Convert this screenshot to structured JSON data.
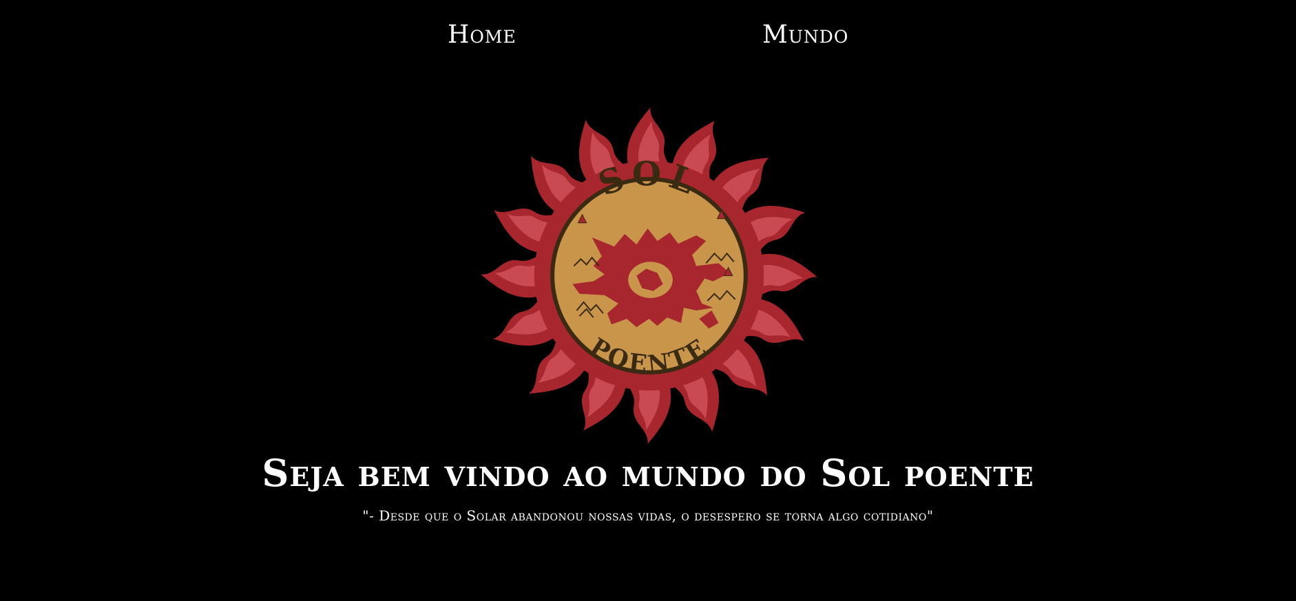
{
  "nav": {
    "items": [
      {
        "label": "Home"
      },
      {
        "label": "Mundo"
      }
    ]
  },
  "logo": {
    "top_text": "SOL",
    "bottom_text": "POENTE",
    "colors": {
      "flame_outer": "#a8262e",
      "flame_inner": "#c94a52",
      "seal_fill": "#c9954b",
      "seal_border": "#3a2a12",
      "map_red": "#a8262e"
    }
  },
  "hero": {
    "title": "Seja bem vindo ao mundo do Sol poente",
    "quote": "\"- Desde que o Solar abandonou nossas vidas, o desespero se torna algo cotidiano\""
  },
  "colors": {
    "background": "#000000",
    "text": "#ffffff"
  }
}
